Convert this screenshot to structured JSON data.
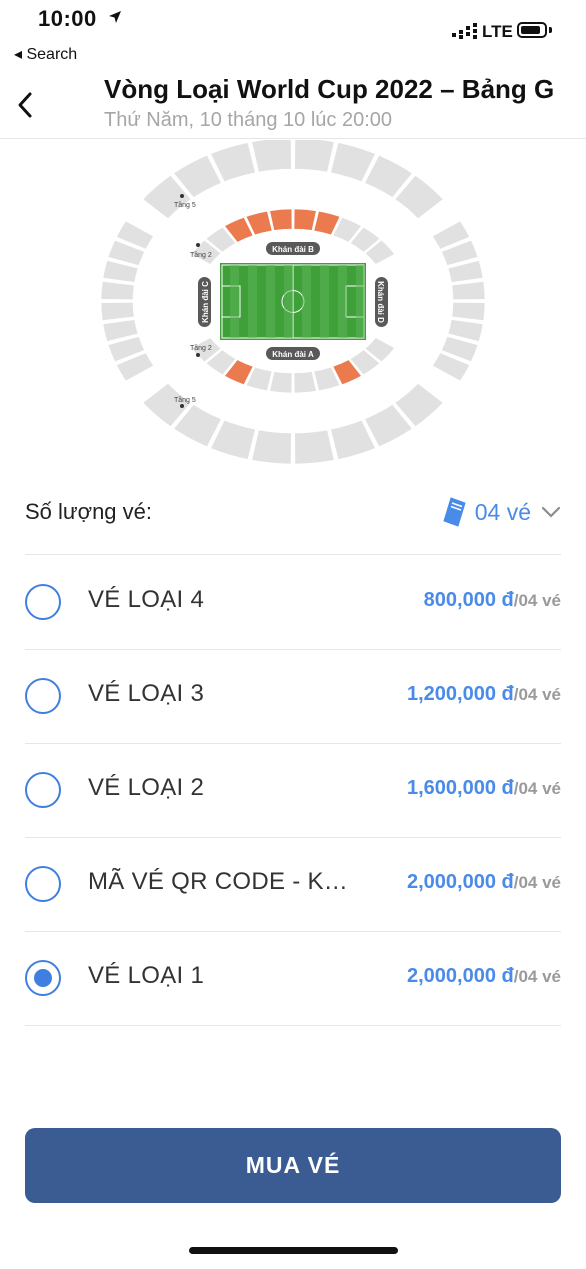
{
  "status_bar": {
    "time": "10:00",
    "back_app": "◂ Search",
    "network": "LTE"
  },
  "header": {
    "title": "Vòng Loại World Cup 2022 – Bảng G",
    "subtitle": "Thứ Năm, 10 tháng 10 lúc 20:00"
  },
  "stadium": {
    "stand_a": "Khán đài A",
    "stand_b": "Khán đài B",
    "stand_c": "Khán đài C",
    "stand_d": "Khán đài D",
    "tier_5": "Tầng 5",
    "tier_2": "Tầng 2",
    "colors": {
      "available": "#e1e1e1",
      "highlight": "#ec7a4f",
      "pitch": "#3fa03a",
      "label_bg": "#595959"
    }
  },
  "quantity": {
    "label": "Số lượng vé:",
    "value": "04 vé"
  },
  "options": [
    {
      "name": "VÉ LOẠI 4",
      "price": "800,000 đ",
      "per": "/04 vé",
      "selected": false
    },
    {
      "name": "VÉ LOẠI 3",
      "price": "1,200,000 đ",
      "per": "/04 vé",
      "selected": false
    },
    {
      "name": "VÉ LOẠI 2",
      "price": "1,600,000 đ",
      "per": "/04 vé",
      "selected": false
    },
    {
      "name": "MÃ VÉ QR CODE - Khán đài",
      "price": "2,000,000 đ",
      "per": "/04 vé",
      "selected": false
    },
    {
      "name": "VÉ LOẠI 1",
      "price": "2,000,000 đ",
      "per": "/04 vé",
      "selected": true
    }
  ],
  "buy_button": "MUA VÉ",
  "theme": {
    "accent": "#4a8ae8",
    "button": "#3b5b93"
  }
}
